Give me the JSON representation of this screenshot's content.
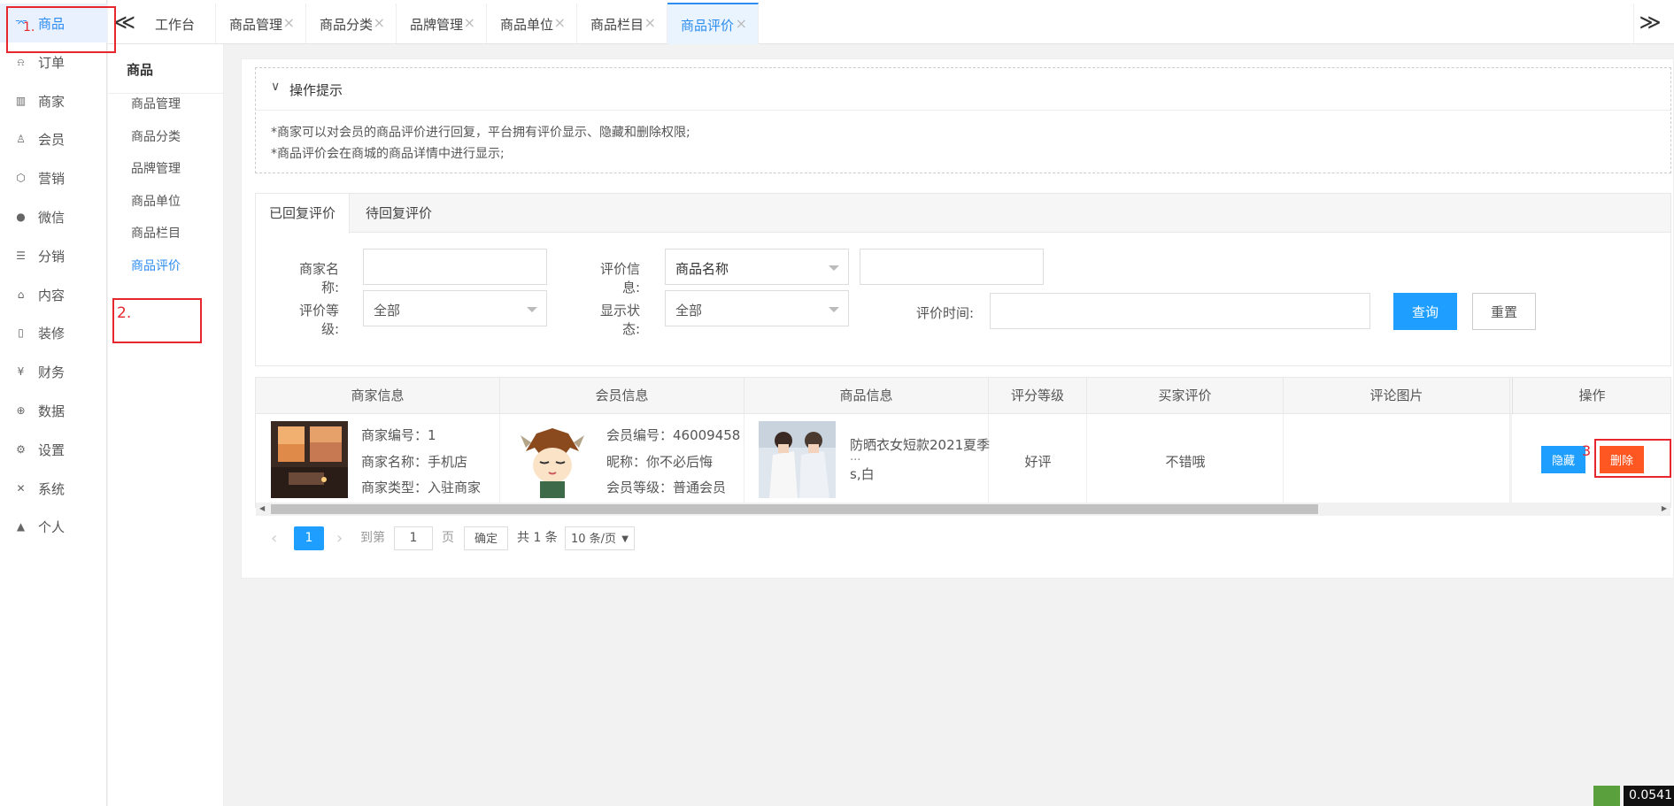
{
  "nav": {
    "items": [
      {
        "label": "商品",
        "icon": "cart-icon"
      },
      {
        "label": "订单",
        "icon": "bell-icon"
      },
      {
        "label": "商家",
        "icon": "building-icon"
      },
      {
        "label": "会员",
        "icon": "user-icon"
      },
      {
        "label": "营销",
        "icon": "cube-icon"
      },
      {
        "label": "微信",
        "icon": "wechat-icon"
      },
      {
        "label": "分销",
        "icon": "layers-icon"
      },
      {
        "label": "内容",
        "icon": "sofa-icon"
      },
      {
        "label": "装修",
        "icon": "tablet-icon"
      },
      {
        "label": "财务",
        "icon": "yen-icon"
      },
      {
        "label": "数据",
        "icon": "globe-icon"
      },
      {
        "label": "设置",
        "icon": "gear-icon"
      },
      {
        "label": "系统",
        "icon": "tools-icon"
      },
      {
        "label": "个人",
        "icon": "person-icon"
      }
    ],
    "active_index": 0
  },
  "submenu": {
    "title": "商品",
    "items": [
      "商品管理",
      "商品分类",
      "品牌管理",
      "商品单位",
      "商品栏目",
      "商品评价"
    ],
    "active_index": 5
  },
  "tabs": {
    "items": [
      "工作台",
      "商品管理",
      "商品分类",
      "品牌管理",
      "商品单位",
      "商品栏目",
      "商品评价"
    ],
    "active_index": 6,
    "prev_symbol": "≪",
    "next_symbol": "≫",
    "close_symbol": "×"
  },
  "tips": {
    "title": "操作提示",
    "lines": [
      "*商家可以对会员的商品评价进行回复，平台拥有评价显示、隐藏和删除权限;",
      "*商品评价会在商城的商品详情中进行显示;"
    ]
  },
  "search": {
    "tabs": [
      "已回复评价",
      "待回复评价"
    ],
    "active_tab": 0,
    "merchant_label": "商家名称:",
    "merchant_value": "",
    "eval_info_label": "评价信息:",
    "eval_info_select": "商品名称",
    "eval_info_value": "",
    "grade_label": "评价等级:",
    "grade_value": "全部",
    "status_label": "显示状态:",
    "status_value": "全部",
    "time_label": "评价时间:",
    "time_value": "",
    "query_btn": "查询",
    "reset_btn": "重置"
  },
  "table": {
    "headers": [
      "商家信息",
      "会员信息",
      "商品信息",
      "评分等级",
      "买家评价",
      "评论图片",
      "操作"
    ],
    "rows": [
      {
        "merchant": {
          "line1": "商家编号：1",
          "line2": "商家名称：手机店",
          "line3": "商家类型：入驻商家"
        },
        "member": {
          "line1": "会员编号：46009458",
          "line2": "昵称：你不必后悔",
          "line3": "会员等级：普通会员"
        },
        "product": {
          "line1": "防晒衣女短款2021夏季",
          "line2": "...",
          "line3": "s,白"
        },
        "grade": "好评",
        "comment": "不错哦",
        "hide_btn": "隐藏",
        "delete_btn": "删除"
      }
    ]
  },
  "pager": {
    "current": "1",
    "goto_label": "到第",
    "goto_value": "1",
    "page_unit": "页",
    "confirm": "确定",
    "total": "共 1 条",
    "page_size": "10 条/页"
  },
  "annotations": {
    "step1": "1.",
    "step2": "2.",
    "step3": "3"
  },
  "corner_badge": "0.0541"
}
